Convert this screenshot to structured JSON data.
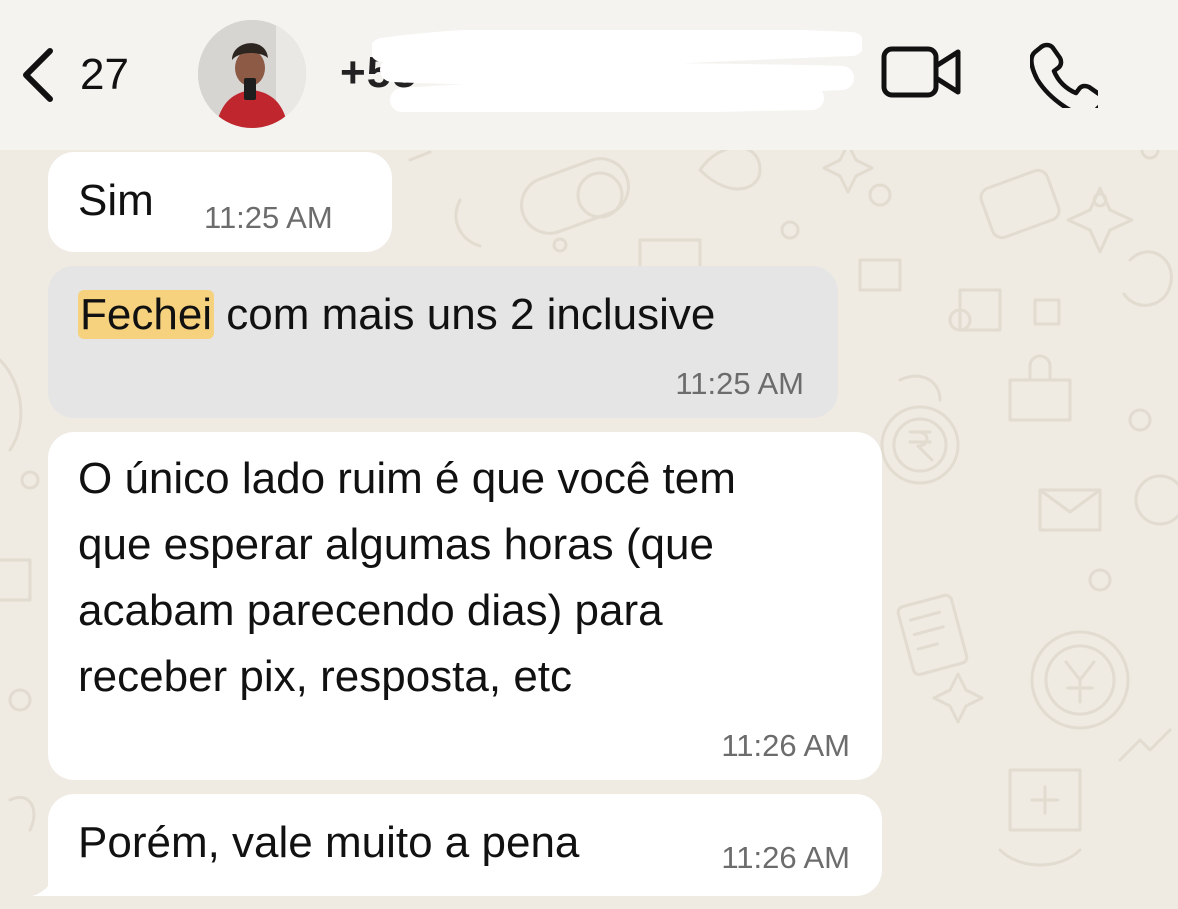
{
  "header": {
    "back_count": "27",
    "contact_name": "+55",
    "icons": {
      "back": "chevron-left-icon",
      "video": "video-camera-icon",
      "call": "phone-icon"
    }
  },
  "messages": [
    {
      "text": "Sim",
      "time": "11:25 AM"
    },
    {
      "highlight_word": "Fechei",
      "text_rest": " com mais uns 2 inclusive",
      "time": "11:25 AM"
    },
    {
      "lines": [
        "O único lado ruim é que você tem",
        "que esperar algumas horas (que",
        "acabam parecendo dias) para",
        "receber pix, resposta, etc"
      ],
      "time": "11:26 AM"
    },
    {
      "text": "Porém, vale muito a pena",
      "time": "11:26 AM"
    }
  ],
  "colors": {
    "chat_background": "#efeae2",
    "bubble": "#ffffff",
    "highlighted_bubble": "#e6e5e6",
    "search_highlight": "#f6d27e"
  }
}
